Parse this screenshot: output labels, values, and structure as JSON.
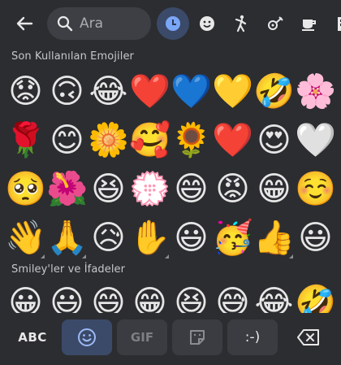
{
  "search": {
    "placeholder": "Ara"
  },
  "categories": [
    {
      "icon": "clock-icon",
      "active": true
    },
    {
      "icon": "smiley-icon",
      "glyph": "☻"
    },
    {
      "icon": "person-icon",
      "glyph": "🕺"
    },
    {
      "icon": "animals-icon",
      "glyph": "🐾"
    },
    {
      "icon": "food-icon",
      "glyph": "☕"
    },
    {
      "icon": "travel-icon",
      "glyph": "🏢"
    }
  ],
  "recent": {
    "title": "Son Kullanılan Emojiler",
    "emojis": [
      "😟",
      "🙃",
      "😂",
      "❤️",
      "💙",
      "💛",
      "🤣",
      "🌸",
      "🌹",
      "😊",
      "🌼",
      "🥰",
      "🌻",
      "❤️",
      "😍",
      "🤍",
      "🥺",
      "🌺",
      "😆",
      "💮",
      "😄",
      "😡",
      "😁",
      "☺️",
      "👋",
      "🙏",
      "😥",
      "✋",
      "😃",
      "🥳",
      "👍",
      "😃"
    ]
  },
  "smileys": {
    "title": "Smiley'ler ve İfadeler",
    "emojis": [
      "😀",
      "😃",
      "😄",
      "😁",
      "😆",
      "😅",
      "😂",
      "🤣"
    ]
  },
  "bottom": {
    "abc_label": "ABC",
    "gif_label": "GIF",
    "emoticon_label": ":-)"
  }
}
